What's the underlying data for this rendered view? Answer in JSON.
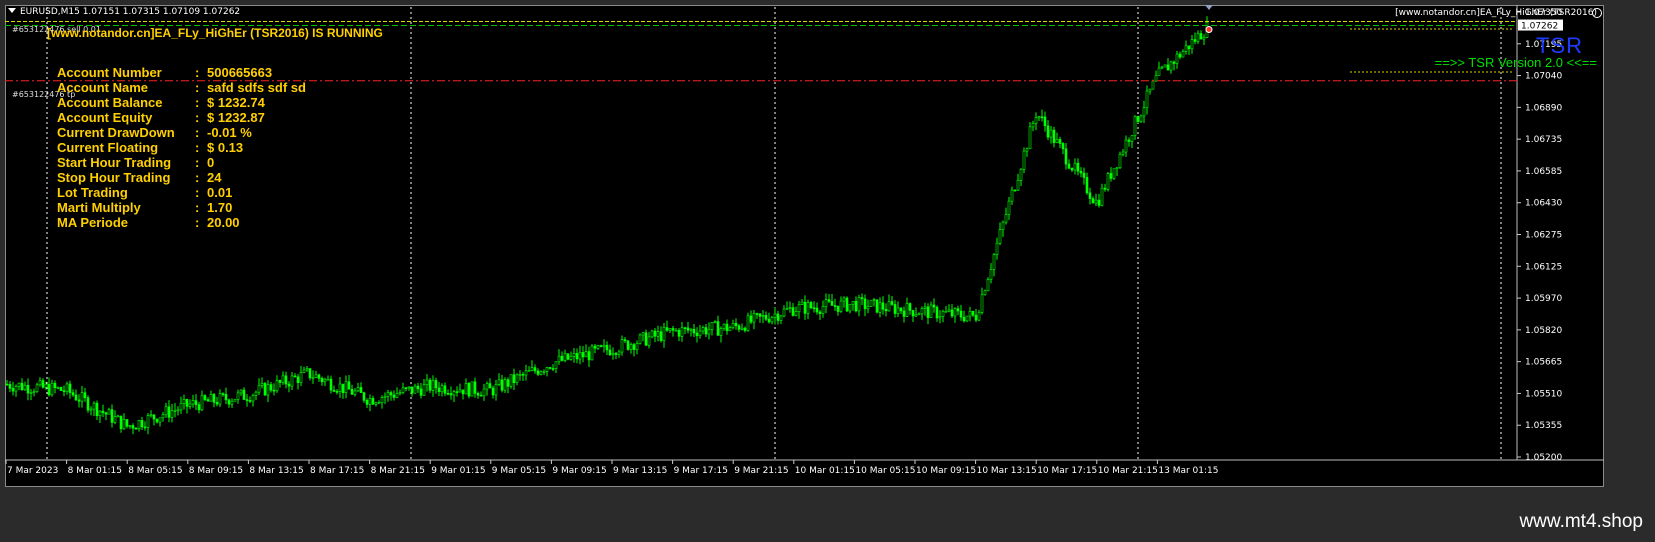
{
  "chart": {
    "symbol_line": "EURUSD,M15  1.07151 1.07315 1.07109 1.07262",
    "ea_status": "[www.notandor.cn]EA_FLy_HiGhEr (TSR2016) IS RUNNING",
    "top_right_label": "[www.notandor.cn]EA_FLy_HiGhEr (TSR2016)",
    "tsr_logo": "TSR",
    "tsr_version": "==>>  TSR Version 2.0  <<==",
    "orders": [
      {
        "label": "#653122476 sell 0.01"
      },
      {
        "label": "#653122476 tp"
      }
    ]
  },
  "account_panel": [
    {
      "key": "Account Number",
      "value": "500665663"
    },
    {
      "key": "Account Name",
      "value": "safd    sdfs sdf  sd"
    },
    {
      "key": "Account Balance",
      "value": "$ 1232.74"
    },
    {
      "key": "Account Equity",
      "value": "$ 1232.87"
    },
    {
      "key": "Current DrawDown",
      "value": "-0.01 %"
    },
    {
      "key": "Current Floating",
      "value": "$ 0.13"
    },
    {
      "key": "Start Hour Trading",
      "value": "0"
    },
    {
      "key": "Stop Hour Trading",
      "value": "24"
    },
    {
      "key": "Lot Trading",
      "value": "0.01"
    },
    {
      "key": "Marti Multiply",
      "value": "1.70"
    },
    {
      "key": "MA Periode",
      "value": "20.00"
    }
  ],
  "watermark": "www.mt4.shop",
  "colors": {
    "background": "#000000",
    "candles": "#00ff00",
    "account_text": "#ffd000",
    "tsr_logo": "#1e3cff",
    "current_price_line": "#00c000",
    "tp_line": "#ff2020"
  },
  "icons": {
    "symbol_menu": "triangle-down-icon",
    "expert_status": "smiley-icon",
    "scroll_marker": "triangle-down-icon"
  },
  "chart_data": {
    "type": "candlestick",
    "symbol": "EURUSD",
    "timeframe": "M15",
    "ohlc_last": {
      "open": 1.07151,
      "high": 1.07315,
      "low": 1.07109,
      "close": 1.07262
    },
    "current_price": 1.07262,
    "price_labels": [
      "1.07350",
      "1.07195",
      "1.07040",
      "1.06890",
      "1.06735",
      "1.06585",
      "1.06430",
      "1.06275",
      "1.06125",
      "1.05970",
      "1.05820",
      "1.05665",
      "1.05510",
      "1.05355",
      "1.05200"
    ],
    "time_labels": [
      "7 Mar 2023",
      "8 Mar 01:15",
      "8 Mar 05:15",
      "8 Mar 09:15",
      "8 Mar 13:15",
      "8 Mar 17:15",
      "8 Mar 21:15",
      "9 Mar 01:15",
      "9 Mar 05:15",
      "9 Mar 09:15",
      "9 Mar 13:15",
      "9 Mar 17:15",
      "9 Mar 21:15",
      "10 Mar 01:15",
      "10 Mar 05:15",
      "10 Mar 09:15",
      "10 Mar 13:15",
      "10 Mar 17:15",
      "10 Mar 21:15",
      "13 Mar 01:15"
    ],
    "ylim": [
      1.052,
      1.0735
    ],
    "tp_level": 1.07,
    "day_separators_at": [
      "8 Mar 00:00",
      "9 Mar 00:00",
      "10 Mar 00:00",
      "13 Mar 00:00"
    ],
    "price_path": [
      [
        "7 Mar 2023",
        1.0556
      ],
      [
        "8 Mar 01:15",
        1.0553
      ],
      [
        "8 Mar 05:15",
        1.0536
      ],
      [
        "8 Mar 09:15",
        1.0546
      ],
      [
        "8 Mar 13:15",
        1.0551
      ],
      [
        "8 Mar 17:15",
        1.0561
      ],
      [
        "8 Mar 21:15",
        1.0549
      ],
      [
        "9 Mar 01:15",
        1.0555
      ],
      [
        "9 Mar 05:15",
        1.0553
      ],
      [
        "9 Mar 09:15",
        1.0566
      ],
      [
        "9 Mar 13:15",
        1.0573
      ],
      [
        "9 Mar 17:15",
        1.0581
      ],
      [
        "9 Mar 21:15",
        1.0583
      ],
      [
        "10 Mar 01:15",
        1.0592
      ],
      [
        "10 Mar 05:15",
        1.0594
      ],
      [
        "10 Mar 09:15",
        1.0591
      ],
      [
        "10 Mar 13:15",
        1.0588
      ],
      [
        "10 Mar 17:15",
        1.0685
      ],
      [
        "10 Mar 21:15",
        1.0642
      ],
      [
        "13 Mar 01:15",
        1.0702
      ],
      [
        "13 Mar 02:30",
        1.07262
      ]
    ]
  }
}
